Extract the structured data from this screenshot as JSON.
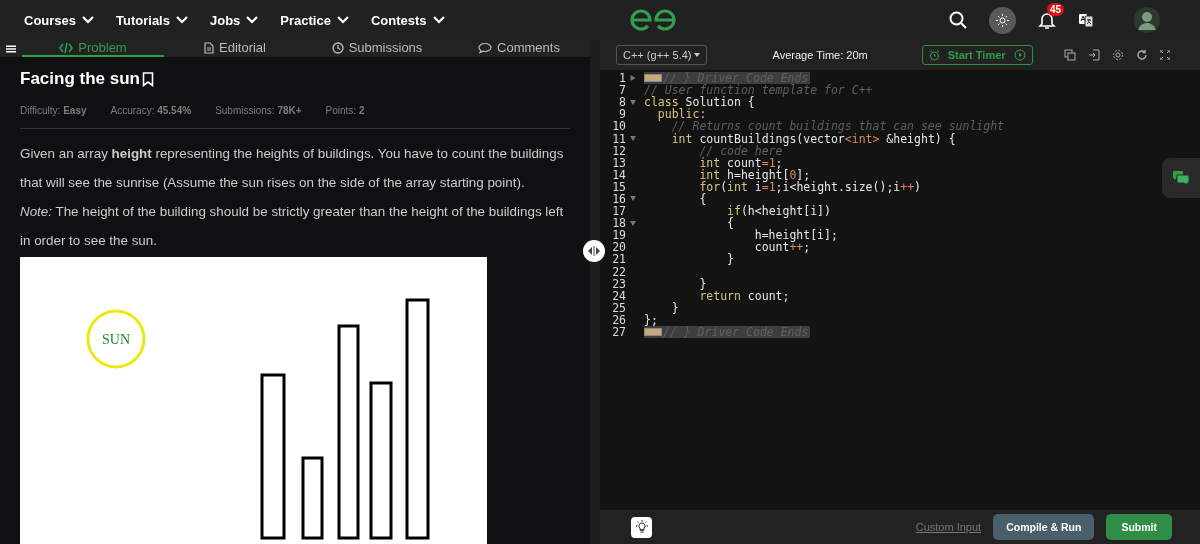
{
  "nav": {
    "items": [
      {
        "label": "Courses"
      },
      {
        "label": "Tutorials"
      },
      {
        "label": "Jobs"
      },
      {
        "label": "Practice"
      },
      {
        "label": "Contests"
      }
    ],
    "notifications": "45"
  },
  "tabs": [
    {
      "label": "Problem",
      "selected": true
    },
    {
      "label": "Editorial",
      "selected": false
    },
    {
      "label": "Submissions",
      "selected": false
    },
    {
      "label": "Comments",
      "selected": false
    }
  ],
  "problem": {
    "title": "Facing the sun",
    "bookmarked": false,
    "meta": [
      "Difficulty: **Easy**",
      "Accuracy: **45.54%**",
      "Submissions: **78K+**",
      "Points: **2**"
    ],
    "paragraphs": [
      "Given an array **height** representing the heights of buildings. You have to count the buildings that will see the sunrise (Assume the sun rises on the side of the array starting point).",
      "*Note:* The height of the building should be strictly greater than the height of the buildings left in order to see the sun."
    ],
    "figure": {
      "sun_label": "SUN"
    }
  },
  "editor": {
    "language": "C++ (g++ 5.4)",
    "average_time": "Average Time: 20m",
    "timer_button": "Start Timer",
    "lines": [
      {
        "number": "1",
        "kind": "collapsed",
        "folded": true,
        "highlighted": true,
        "tokens": [
          {
            "kind": "comment",
            "text": "// } Driver Code Ends"
          }
        ]
      },
      {
        "number": "7",
        "kind": "plain",
        "folded": false,
        "highlighted": false,
        "tokens": [
          {
            "kind": "comment",
            "text": "// User function template for C++"
          }
        ]
      },
      {
        "number": "8",
        "kind": "expanded",
        "folded": false,
        "highlighted": false,
        "tokens": [
          {
            "kind": "keyword",
            "text": "class"
          },
          {
            "kind": "plain",
            "text": " Solution {"
          }
        ]
      },
      {
        "number": "9",
        "kind": "plain",
        "folded": false,
        "highlighted": false,
        "tokens": [
          {
            "kind": "keyword",
            "text": "  public:"
          }
        ]
      },
      {
        "number": "10",
        "kind": "plain",
        "folded": false,
        "highlighted": false,
        "tokens": [
          {
            "kind": "comment",
            "text": "    // Returns count buildings that can see sunlight"
          }
        ]
      },
      {
        "number": "11",
        "kind": "expanded",
        "folded": false,
        "highlighted": false,
        "tokens": [
          {
            "kind": "keyword",
            "text": "    int"
          },
          {
            "kind": "plain",
            "text": " countBuildings(vector"
          },
          {
            "kind": "operator",
            "text": "<int>"
          },
          {
            "kind": "plain",
            "text": " &height) {"
          }
        ]
      },
      {
        "number": "12",
        "kind": "plain",
        "folded": false,
        "highlighted": false,
        "tokens": [
          {
            "kind": "comment",
            "text": "        // code here"
          }
        ]
      },
      {
        "number": "13",
        "kind": "plain",
        "folded": false,
        "highlighted": false,
        "tokens": [
          {
            "kind": "keyword",
            "text": "        int"
          },
          {
            "kind": "plain",
            "text": " count"
          },
          {
            "kind": "operator",
            "text": "=1"
          },
          {
            "kind": "plain",
            "text": ";"
          }
        ]
      },
      {
        "number": "14",
        "kind": "plain",
        "folded": false,
        "highlighted": false,
        "tokens": [
          {
            "kind": "keyword",
            "text": "        int"
          },
          {
            "kind": "plain",
            "text": " h=height["
          },
          {
            "kind": "operator",
            "text": "0"
          },
          {
            "kind": "plain",
            "text": "];"
          }
        ]
      },
      {
        "number": "15",
        "kind": "plain",
        "folded": false,
        "highlighted": false,
        "tokens": [
          {
            "kind": "keyword",
            "text": "        for"
          },
          {
            "kind": "plain",
            "text": "("
          },
          {
            "kind": "keyword",
            "text": "int"
          },
          {
            "kind": "plain",
            "text": " i"
          },
          {
            "kind": "operator",
            "text": "=1"
          },
          {
            "kind": "plain",
            "text": ";i<height.size();i"
          },
          {
            "kind": "operator",
            "text": "++"
          },
          {
            "kind": "plain",
            "text": ")"
          }
        ]
      },
      {
        "number": "16",
        "kind": "expanded",
        "folded": false,
        "highlighted": false,
        "tokens": [
          {
            "kind": "plain",
            "text": "        {"
          }
        ]
      },
      {
        "number": "17",
        "kind": "plain",
        "folded": false,
        "highlighted": false,
        "tokens": [
          {
            "kind": "keyword",
            "text": "            if"
          },
          {
            "kind": "plain",
            "text": "(h<height[i])"
          }
        ]
      },
      {
        "number": "18",
        "kind": "expanded",
        "folded": false,
        "highlighted": false,
        "tokens": [
          {
            "kind": "plain",
            "text": "            {"
          }
        ]
      },
      {
        "number": "19",
        "kind": "plain",
        "folded": false,
        "highlighted": false,
        "tokens": [
          {
            "kind": "plain",
            "text": "                h=height[i];"
          }
        ]
      },
      {
        "number": "20",
        "kind": "plain",
        "folded": false,
        "highlighted": false,
        "tokens": [
          {
            "kind": "plain",
            "text": "                count"
          },
          {
            "kind": "operator",
            "text": "++"
          },
          {
            "kind": "plain",
            "text": ";"
          }
        ]
      },
      {
        "number": "21",
        "kind": "plain",
        "folded": false,
        "highlighted": false,
        "tokens": [
          {
            "kind": "plain",
            "text": "            }"
          }
        ]
      },
      {
        "number": "22",
        "kind": "plain",
        "folded": false,
        "highlighted": false
      },
      {
        "number": "23",
        "kind": "plain",
        "folded": false,
        "highlighted": false,
        "tokens": [
          {
            "kind": "plain",
            "text": "        }"
          }
        ]
      },
      {
        "number": "24",
        "kind": "plain",
        "folded": false,
        "highlighted": false,
        "tokens": [
          {
            "kind": "keyword",
            "text": "        return"
          },
          {
            "kind": "plain",
            "text": " count;"
          }
        ]
      },
      {
        "number": "25",
        "kind": "plain",
        "folded": false,
        "highlighted": false,
        "tokens": [
          {
            "kind": "plain",
            "text": "    }"
          }
        ]
      },
      {
        "number": "26",
        "kind": "plain",
        "folded": false,
        "highlighted": false,
        "tokens": [
          {
            "kind": "plain",
            "text": "};"
          }
        ]
      },
      {
        "number": "27",
        "kind": "plain",
        "folded": true,
        "highlighted": true,
        "tokens": [
          {
            "kind": "comment",
            "text": "// } Driver Code Ends"
          }
        ]
      }
    ],
    "custom_input": "Custom Input",
    "compile_button": "Compile & Run",
    "submit_button": "Submit"
  }
}
